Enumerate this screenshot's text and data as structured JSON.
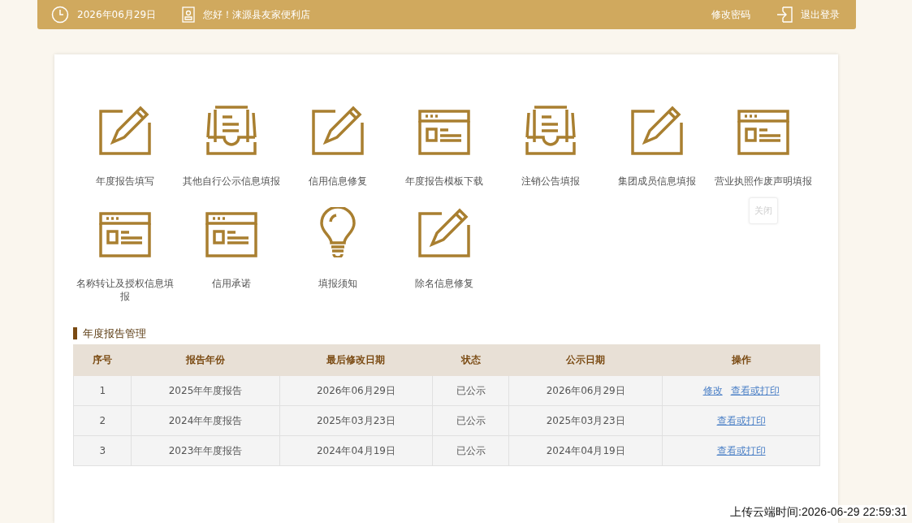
{
  "header": {
    "date": "2026年06月29日",
    "greeting": "您好！涞源县友家便利店",
    "change_password": "修改密码",
    "logout": "退出登录"
  },
  "functions": [
    {
      "label": "年度报告填写",
      "kind": "edit"
    },
    {
      "label": "其他自行公示信息填报",
      "kind": "tray"
    },
    {
      "label": "信用信息修复",
      "kind": "edit"
    },
    {
      "label": "年度报告模板下载",
      "kind": "window"
    },
    {
      "label": "注销公告填报",
      "kind": "tray"
    },
    {
      "label": "集团成员信息填报",
      "kind": "edit"
    },
    {
      "label": "营业执照作废声明填报",
      "kind": "window",
      "tooltip": "关闭"
    },
    {
      "label": "名称转让及授权信息填报",
      "kind": "window"
    },
    {
      "label": "信用承诺",
      "kind": "window"
    },
    {
      "label": "填报须知",
      "kind": "bulb"
    },
    {
      "label": "除名信息修复",
      "kind": "edit"
    }
  ],
  "section_title": "年度报告管理",
  "table": {
    "columns": [
      "序号",
      "报告年份",
      "最后修改日期",
      "状态",
      "公示日期",
      "操作"
    ],
    "rows": [
      {
        "cells": [
          "1",
          "2025年年度报告",
          "2026年06月29日",
          "已公示",
          "2026年06月29日"
        ],
        "actions": [
          "修改",
          "查看或打印"
        ]
      },
      {
        "cells": [
          "2",
          "2024年年度报告",
          "2025年03月23日",
          "已公示",
          "2025年03月23日"
        ],
        "actions": [
          "查看或打印"
        ]
      },
      {
        "cells": [
          "3",
          "2023年年度报告",
          "2024年04月19日",
          "已公示",
          "2024年04月19日"
        ],
        "actions": [
          "查看或打印"
        ]
      }
    ]
  },
  "overlay_timestamp": "上传云端时间:2026-06-29 22:59:31"
}
